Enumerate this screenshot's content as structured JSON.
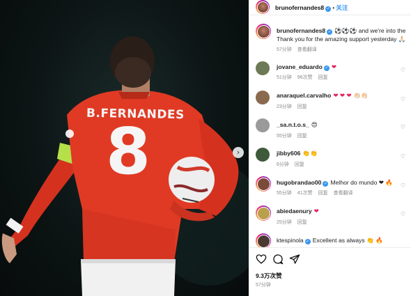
{
  "post": {
    "author": "brunofernandes8",
    "follow_label": "关注",
    "caption_username": "brunofernandes8",
    "caption_line1": "⚽⚽⚽ and we're into the",
    "caption_line2": "Thank you for the amazing support yesterday 🙏🏻",
    "caption_time": "57分钟",
    "caption_translate": "查看翻译",
    "photo_name": "B.FERNANDES",
    "photo_number": "8",
    "next_arrow": "›"
  },
  "comments": [
    {
      "user": "jovane_eduardo",
      "verified": true,
      "text": "❤",
      "time": "51分钟",
      "likes": "96次赞",
      "reply": "回复"
    },
    {
      "user": "anaraquel.carvalho",
      "verified": false,
      "text": "❤ ❤ ❤ 👏🏻👏🏻",
      "time": "23分钟",
      "reply": "回复"
    },
    {
      "user": "_sa.n.t.o.s_",
      "verified": false,
      "text": "😍",
      "time": "55分钟",
      "reply": "回复"
    },
    {
      "user": "jibby606",
      "verified": false,
      "text": "👏👏",
      "time": "6分钟",
      "reply": "回复"
    },
    {
      "user": "hugobrandao00",
      "verified": true,
      "text": "Melhor do mundo ❤ 🔥",
      "time": "55分钟",
      "likes": "41次赞",
      "reply": "回复",
      "translate": "查看翻译"
    },
    {
      "user": "abiedaenury",
      "verified": false,
      "text": "❤",
      "time": "25分钟",
      "reply": "回复"
    },
    {
      "user": "ktespinola",
      "verified": true,
      "text": "Excellent as always 👏 🔥"
    }
  ],
  "footer": {
    "likes": "9.3万次赞",
    "time": "57分钟"
  },
  "icons": [
    "heart-icon",
    "comment-icon",
    "share-icon",
    "next-arrow-icon",
    "verified-icon",
    "comment-like-icon"
  ]
}
